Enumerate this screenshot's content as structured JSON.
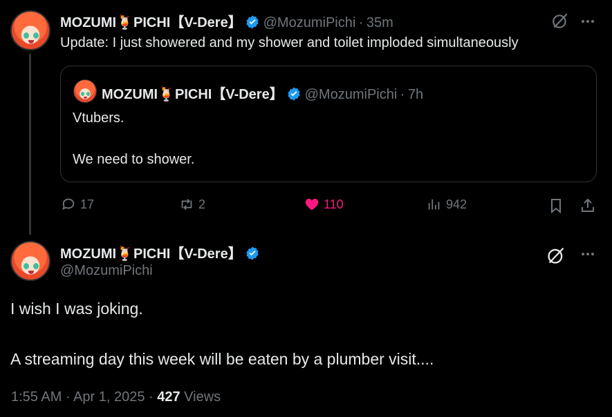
{
  "reply_tweet": {
    "display_name": "MOZUMI🍹PICHI【V-Dere】",
    "handle": "@MozumiPichi",
    "time": "35m",
    "text": "Update: I just showered and my shower and toilet imploded simultaneously",
    "quote": {
      "display_name": "MOZUMI🍹PICHI【V-Dere】",
      "handle": "@MozumiPichi",
      "time": "7h",
      "line1": "Vtubers.",
      "line2": "We need to shower."
    },
    "actions": {
      "replies": "17",
      "reposts": "2",
      "likes": "110",
      "views": "942"
    }
  },
  "main_tweet": {
    "display_name": "MOZUMI🍹PICHI【V-Dere】",
    "handle": "@MozumiPichi",
    "line1": "I wish I was joking.",
    "line2": "A streaming day this week will be eaten by a plumber visit....",
    "timestamp": "1:55 AM · Apr 1, 2025 · ",
    "views_count": "427",
    "views_label": " Views"
  },
  "colors": {
    "background": "#000000",
    "text": "#e7e9ea",
    "muted": "#71767b",
    "like_active": "#f91880",
    "verified": "#1d9bf0"
  }
}
